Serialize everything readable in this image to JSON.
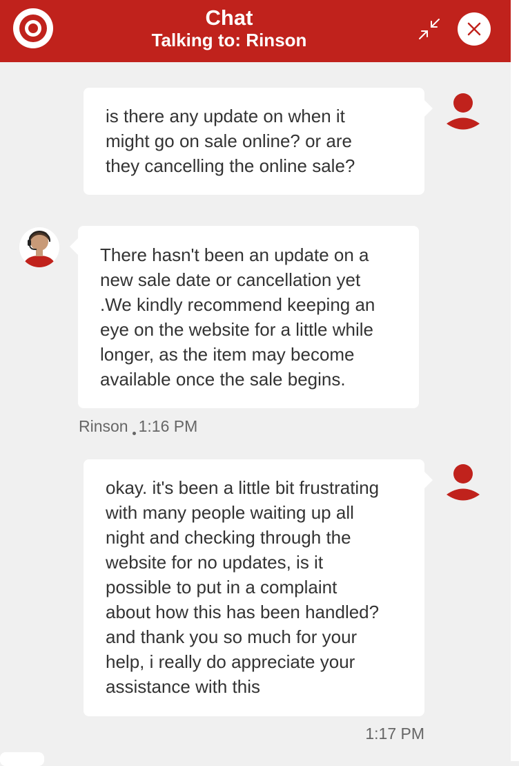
{
  "header": {
    "title": "Chat",
    "subtitle": "Talking to: Rinson",
    "logo_icon": "target-bullseye-icon",
    "minimize_icon": "collapse-arrows-icon",
    "close_icon": "close-icon",
    "brand_color": "#c0221c"
  },
  "messages": [
    {
      "sender": "user",
      "text": "is there any update on when it\nmight go on sale online? or are\nthey cancelling the online sale?"
    },
    {
      "sender": "agent",
      "text": "There hasn't been an update on a\nnew sale date or cancellation yet\n.We kindly recommend keeping an\neye on the website for a little while\nlonger, as the item may become\navailable once the sale begins.",
      "author": "Rinson",
      "time": "1:16 PM"
    },
    {
      "sender": "user",
      "text": "okay. it's been a little bit frustrating\nwith many people waiting up all\nnight and checking through the\nwebsite for no updates, is it\npossible to put in a complaint\nabout how this has been handled?\nand thank you so much for your\nhelp, i really do appreciate your\nassistance with this",
      "time": "1:17 PM"
    }
  ]
}
